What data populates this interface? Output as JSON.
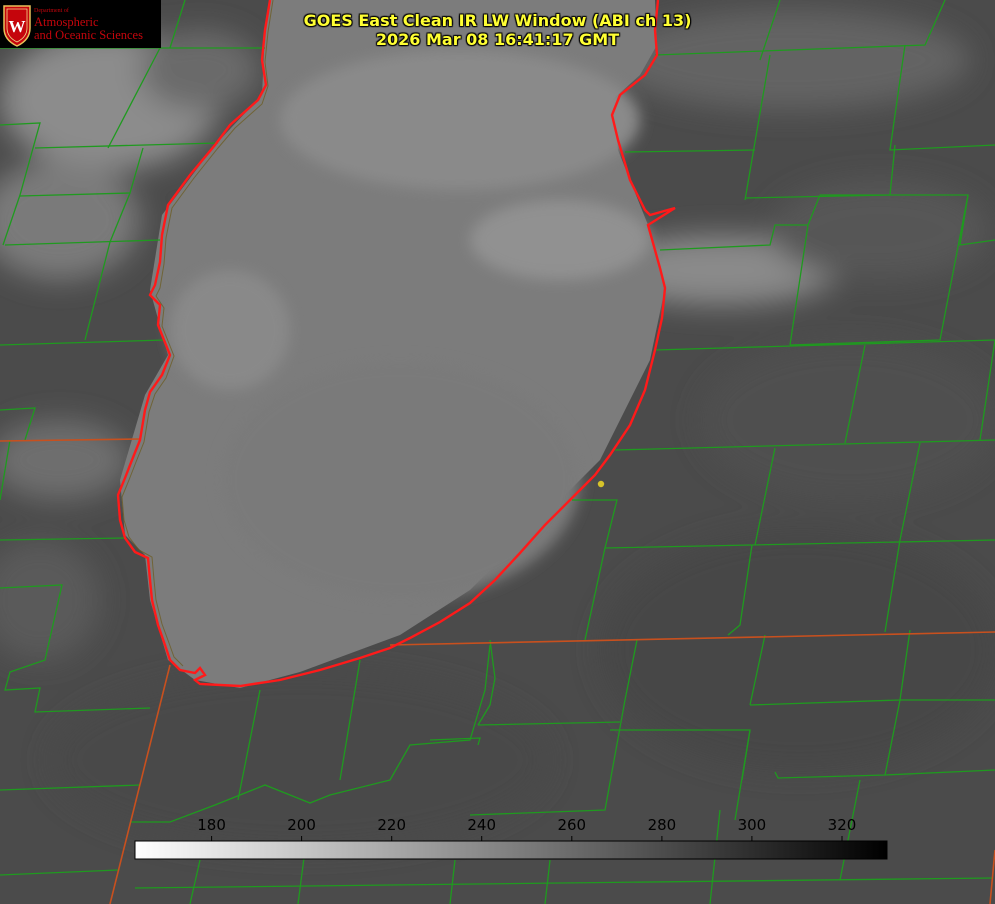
{
  "header": {
    "title_line1": "GOES East Clean IR LW Window (ABI ch 13)",
    "title_line2": "2026 Mar 08 16:41:17 GMT"
  },
  "logo": {
    "department_label": "Department of",
    "line1": "Atmospheric",
    "line2": "and Oceanic Sciences",
    "shield_letter": "W",
    "brand_color": "#c5050c"
  },
  "colorbar": {
    "tick_labels": [
      "180",
      "200",
      "220",
      "240",
      "260",
      "280",
      "300",
      "320"
    ],
    "range_min": 163,
    "range_max": 330,
    "gradient": "white-to-black"
  },
  "map": {
    "lake_outline_color": "#ff1a1a",
    "county_line_color": "#1f9a1f",
    "state_line_color": "#c8501e",
    "marker_color": "#d6c32a"
  }
}
